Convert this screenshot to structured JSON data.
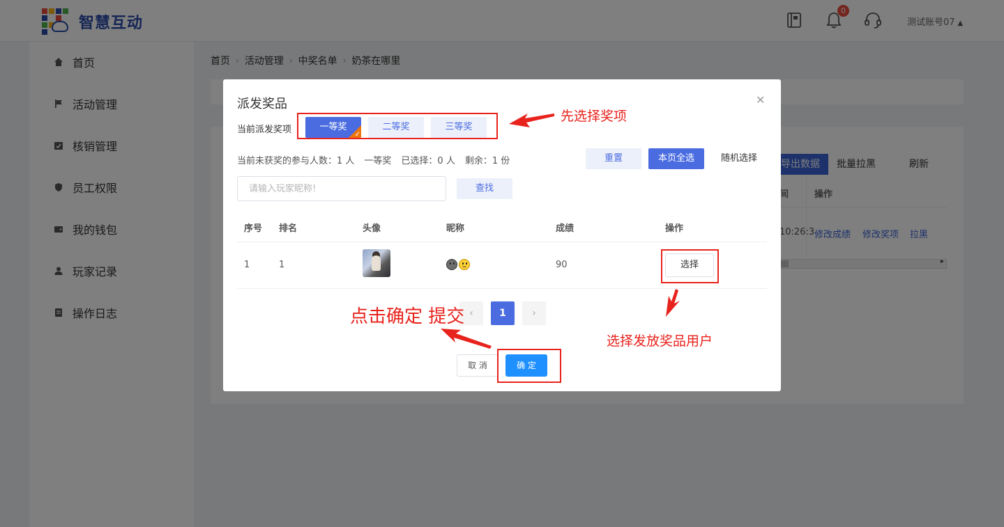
{
  "header": {
    "brand": "智慧互动",
    "notification_count": "0",
    "account_name": "测试账号07",
    "icons": [
      "book-icon",
      "bell-icon",
      "headset-icon"
    ]
  },
  "sidebar": {
    "items": [
      {
        "label": "首页",
        "icon": "home-icon"
      },
      {
        "label": "活动管理",
        "icon": "flag-icon"
      },
      {
        "label": "核销管理",
        "icon": "calendar-check-icon"
      },
      {
        "label": "员工权限",
        "icon": "shield-icon"
      },
      {
        "label": "我的钱包",
        "icon": "wallet-icon"
      },
      {
        "label": "玩家记录",
        "icon": "user-icon"
      },
      {
        "label": "操作日志",
        "icon": "log-icon"
      }
    ]
  },
  "breadcrumb": [
    "首页",
    "活动管理",
    "中奖名单",
    "奶茶在哪里"
  ],
  "background": {
    "buttons": [
      "导出数据",
      "批量拉黑",
      "刷新"
    ],
    "col_partial": "间",
    "col_action": "操作",
    "time_partial": "10:26:3",
    "row_links": [
      "修改成绩",
      "修改奖项",
      "拉黑"
    ]
  },
  "dialog": {
    "title": "派发奖品",
    "prize_label": "当前派发奖项",
    "prizes": [
      {
        "label": "一等奖",
        "active": true
      },
      {
        "label": "二等奖",
        "active": false
      },
      {
        "label": "三等奖",
        "active": false
      }
    ],
    "stats": {
      "unawarded": "当前未获奖的参与人数：1 人",
      "prize": "一等奖",
      "selected": "已选择：0 人",
      "remaining": "剩余：1 份"
    },
    "actions": {
      "reset": "重置",
      "select_page": "本页全选",
      "random": "随机选择"
    },
    "search": {
      "placeholder": "请输入玩家昵称!",
      "button": "查找"
    },
    "table": {
      "columns": [
        "序号",
        "排名",
        "头像",
        "昵称",
        "成绩",
        "操作"
      ],
      "rows": [
        {
          "index": "1",
          "rank": "1",
          "score": "90",
          "action": "选择"
        }
      ]
    },
    "pagination": {
      "current": "1",
      "prev": "‹",
      "next": "›"
    },
    "footer": {
      "cancel": "取 消",
      "confirm": "确 定"
    }
  },
  "annotations": {
    "select_prize": "先选择奖项",
    "select_user": "选择发放奖品用户",
    "confirm_submit": "点击确定 提交",
    "color": "#e8221c"
  }
}
